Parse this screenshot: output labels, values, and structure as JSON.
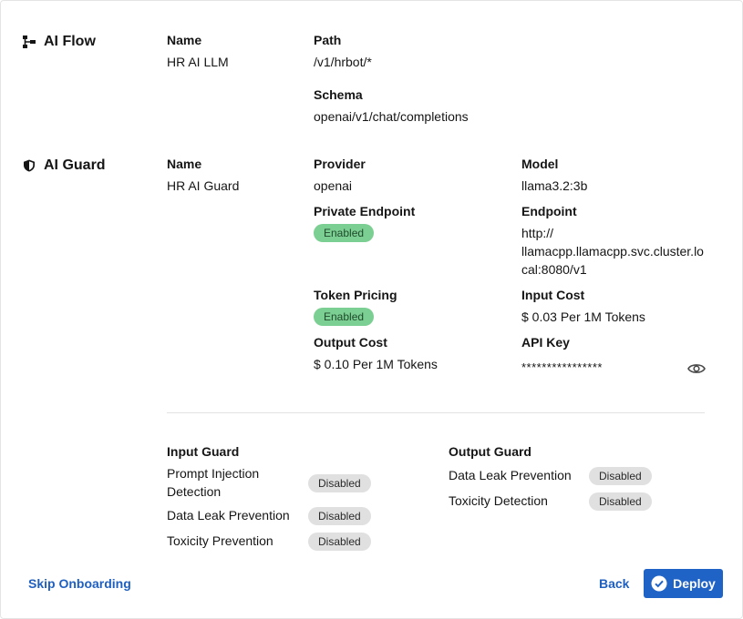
{
  "ai_flow": {
    "title": "AI Flow",
    "name_label": "Name",
    "name_value": "HR AI LLM",
    "path_label": "Path",
    "path_value": "/v1/hrbot/*",
    "schema_label": "Schema",
    "schema_value": "openai/v1/chat/completions"
  },
  "ai_guard": {
    "title": "AI Guard",
    "name_label": "Name",
    "name_value": "HR AI Guard",
    "provider_label": "Provider",
    "provider_value": "openai",
    "model_label": "Model",
    "model_value": "llama3.2:3b",
    "private_endpoint_label": "Private Endpoint",
    "private_endpoint_status": "Enabled",
    "endpoint_label": "Endpoint",
    "endpoint_line1": "http://",
    "endpoint_line2": "llamacpp.llamacpp.svc.cluster.lo",
    "endpoint_line3": "cal:8080/v1",
    "token_pricing_label": "Token Pricing",
    "token_pricing_status": "Enabled",
    "input_cost_label": "Input Cost",
    "input_cost_value": "$ 0.03 Per 1M Tokens",
    "output_cost_label": "Output Cost",
    "output_cost_value": "$ 0.10 Per 1M Tokens",
    "api_key_label": "API Key",
    "api_key_value": "****************"
  },
  "input_guard": {
    "title": "Input Guard",
    "items": [
      {
        "label_line1": "Prompt Injection",
        "label_line2": "Detection",
        "status": "Disabled"
      },
      {
        "label": "Data Leak Prevention",
        "status": "Disabled"
      },
      {
        "label": "Toxicity Prevention",
        "status": "Disabled"
      }
    ]
  },
  "output_guard": {
    "title": "Output Guard",
    "items": [
      {
        "label": "Data Leak Prevention",
        "status": "Disabled"
      },
      {
        "label": "Toxicity Detection",
        "status": "Disabled"
      }
    ]
  },
  "footer": {
    "skip_label": "Skip Onboarding",
    "back_label": "Back",
    "deploy_label": "Deploy"
  },
  "colors": {
    "accent": "#1f63c6",
    "link": "#1f5fbf",
    "enabled_badge": "#7ccf92",
    "disabled_badge": "#e0e0e0"
  }
}
